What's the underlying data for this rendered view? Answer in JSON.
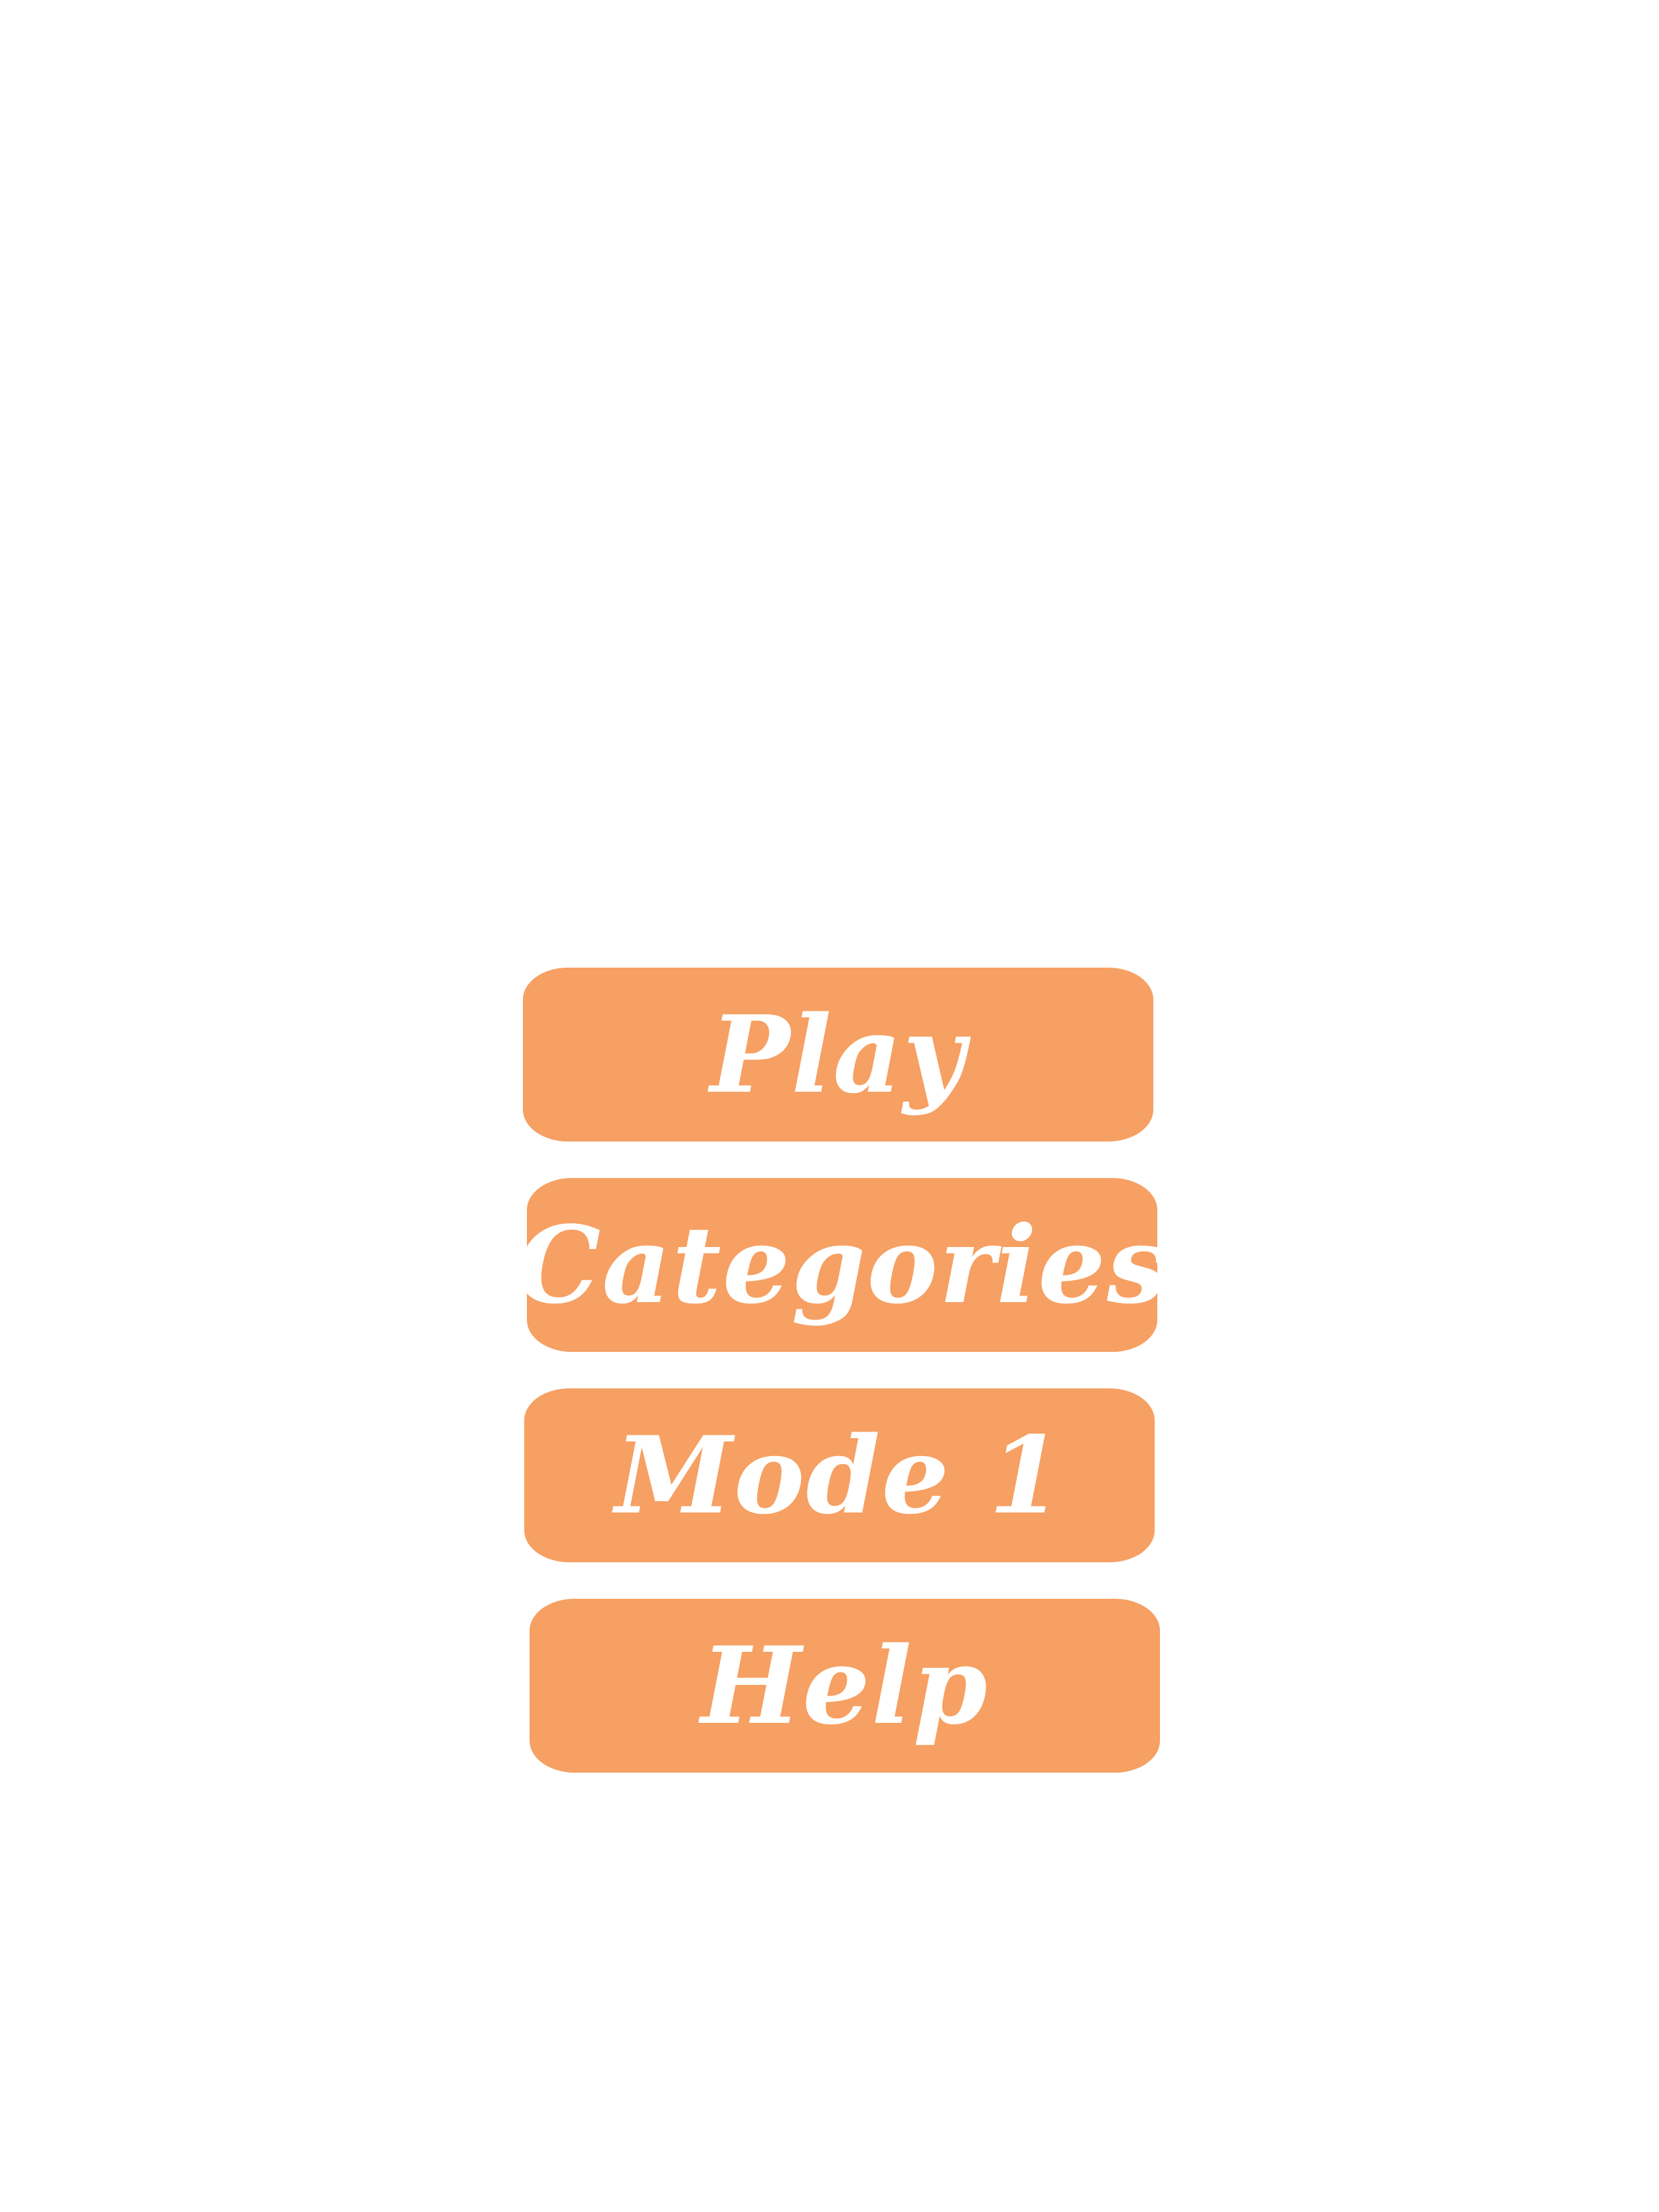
{
  "colors": {
    "background": "#ffffff",
    "button_fill": "#F6A063",
    "button_text": "#ffffff"
  },
  "menu": {
    "play_label": "Play",
    "categories_label": "Categories",
    "mode_label": "Mode 1",
    "help_label": "Help"
  }
}
